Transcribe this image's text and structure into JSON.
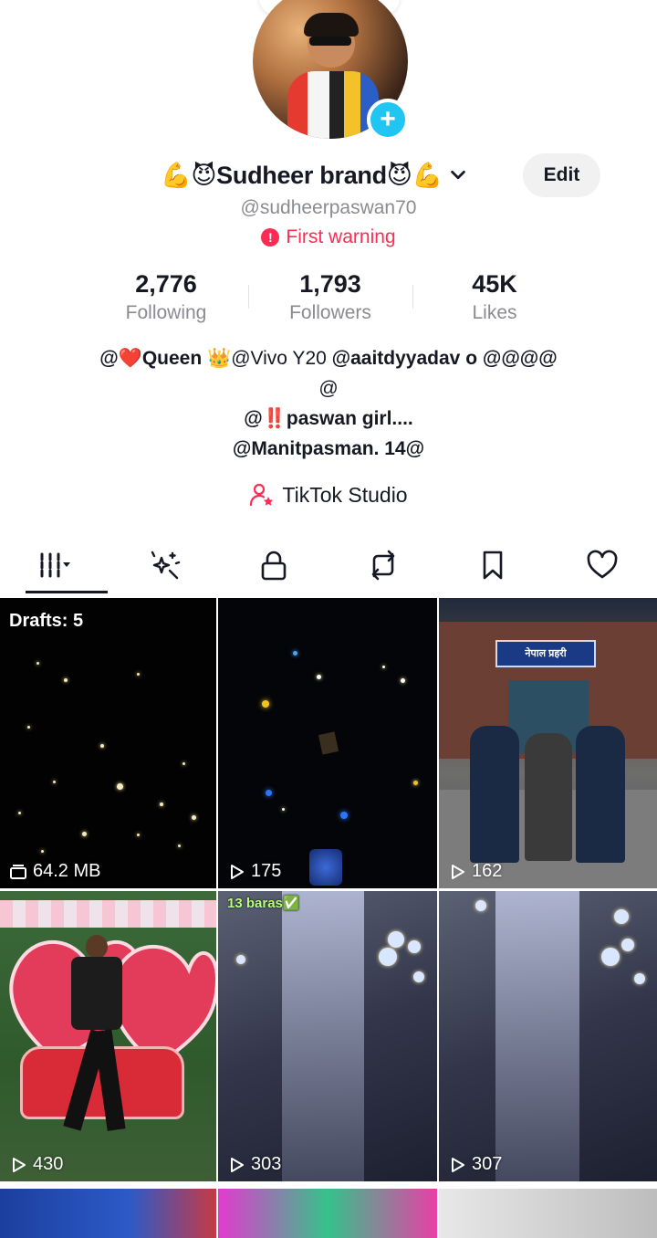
{
  "profile": {
    "display_name": "💪😈Sudheer brand😈💪",
    "handle": "@sudheerpaswan70",
    "warning": "First warning",
    "edit_label": "Edit"
  },
  "stats": [
    {
      "value": "2,776",
      "label": "Following"
    },
    {
      "value": "1,793",
      "label": "Followers"
    },
    {
      "value": "45K",
      "label": "Likes"
    }
  ],
  "bio": {
    "line1_a": "@❤️Queen 👑",
    "line1_b": "@Vivo Y20 ",
    "line1_c": "@aaitdyyadav o @@@@",
    "line2": "@",
    "line3_a": "@",
    "line3_b": "‼️",
    "line3_c": "paswan girl....",
    "line4": "@Manitpasman. 14@"
  },
  "studio_label": "TikTok Studio",
  "tabs": [
    {
      "name": "videos-tab",
      "icon": "grid-icon",
      "active": true
    },
    {
      "name": "effects-tab",
      "icon": "sparkle-icon",
      "active": false
    },
    {
      "name": "private-tab",
      "icon": "lock-icon",
      "active": false
    },
    {
      "name": "reposts-tab",
      "icon": "repost-icon",
      "active": false
    },
    {
      "name": "favorites-tab",
      "icon": "bookmark-icon",
      "active": false
    },
    {
      "name": "liked-tab",
      "icon": "heart-icon",
      "active": false
    }
  ],
  "grid": {
    "drafts_label": "Drafts: 5",
    "drafts_size": "64.2 MB",
    "tiles": [
      {
        "views": "175"
      },
      {
        "views": "162"
      },
      {
        "views": "430"
      },
      {
        "views": "303",
        "overlay": "13 baras✅"
      },
      {
        "views": "307"
      }
    ]
  },
  "colors": {
    "accent": "#fe2c55",
    "add_button": "#20c5f2",
    "text_primary": "#161823",
    "text_secondary": "#8a8b91"
  }
}
